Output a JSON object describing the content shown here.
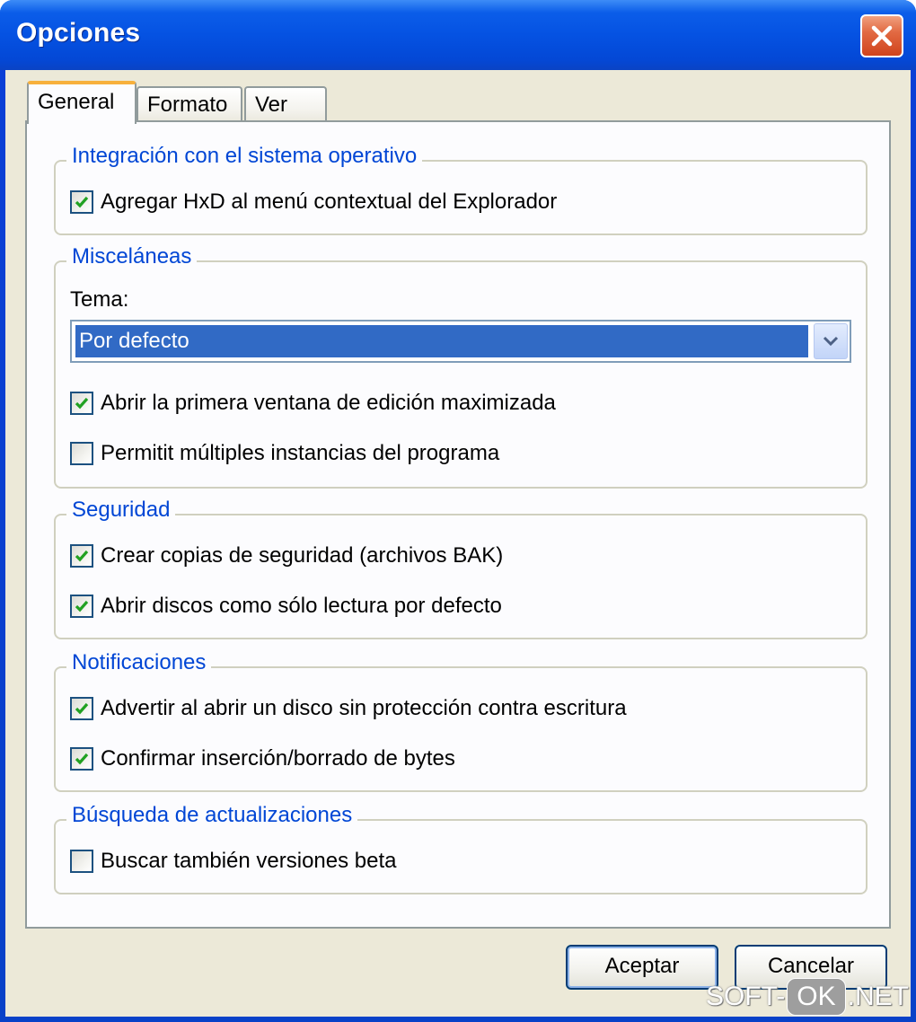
{
  "window": {
    "title": "Opciones"
  },
  "tabs": [
    {
      "label": "General",
      "active": true
    },
    {
      "label": "Formato",
      "active": false
    },
    {
      "label": "Ver",
      "active": false
    }
  ],
  "groups": {
    "integracion": {
      "title": "Integración con el sistema operativo",
      "items": [
        {
          "label": "Agregar HxD al menú contextual del Explorador",
          "checked": true
        }
      ]
    },
    "miscelaneas": {
      "title": "Misceláneas",
      "tema_label": "Tema:",
      "tema_value": "Por defecto",
      "items": [
        {
          "label": "Abrir la primera ventana de edición maximizada",
          "checked": true
        },
        {
          "label": "Permitit múltiples instancias del programa",
          "checked": false
        }
      ]
    },
    "seguridad": {
      "title": "Seguridad",
      "items": [
        {
          "label": "Crear copias de seguridad (archivos BAK)",
          "checked": true
        },
        {
          "label": "Abrir discos como sólo lectura por defecto",
          "checked": true
        }
      ]
    },
    "notificaciones": {
      "title": "Notificaciones",
      "items": [
        {
          "label": "Advertir al abrir un disco sin protección contra escritura",
          "checked": true
        },
        {
          "label": "Confirmar inserción/borrado de bytes",
          "checked": true
        }
      ]
    },
    "busqueda": {
      "title": "Búsqueda de actualizaciones",
      "items": [
        {
          "label": "Buscar también versiones beta",
          "checked": false
        }
      ]
    }
  },
  "buttons": {
    "accept": "Aceptar",
    "cancel": "Cancelar"
  },
  "watermark": {
    "left": "SOFT-",
    "mid": "OK",
    "right": ".NET"
  },
  "colors": {
    "titlebar": "#0552e2",
    "group_title": "#0046d5",
    "selection": "#316ac5",
    "check": "#21a121",
    "dialog_bg": "#ece9d8"
  },
  "icons": {
    "close": "close-icon",
    "check": "checkmark-icon",
    "dropdown": "chevron-down-icon"
  }
}
